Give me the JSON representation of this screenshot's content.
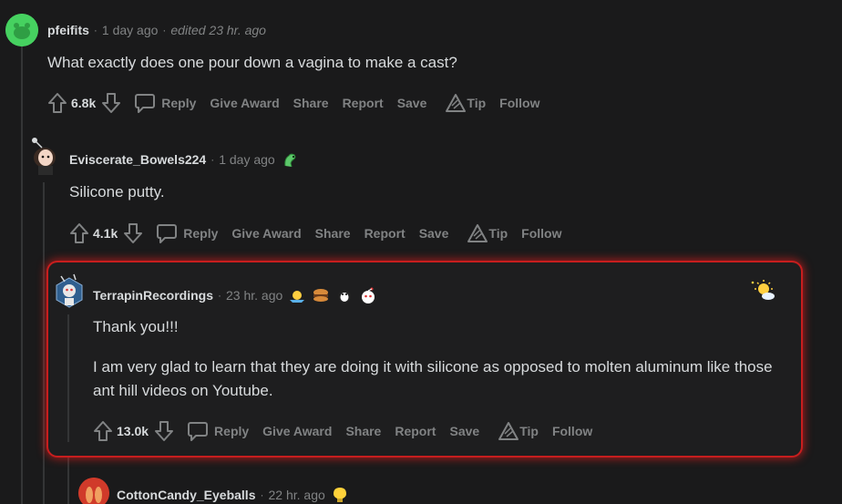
{
  "comments": [
    {
      "author": "pfeifits",
      "time": "1 day ago",
      "edited": "edited 23 hr. ago",
      "body": [
        "What exactly does one pour down a vagina to make a cast?"
      ],
      "votes": "6.8k"
    },
    {
      "author": "Eviscerate_Bowels224",
      "time": "1 day ago",
      "body": [
        "Silicone putty."
      ],
      "votes": "4.1k"
    },
    {
      "author": "TerrapinRecordings",
      "time": "23 hr. ago",
      "body": [
        "Thank you!!!",
        "I am very glad to learn that they are doing it with silicone as opposed to molten aluminum like those ant hill videos on Youtube."
      ],
      "votes": "13.0k"
    },
    {
      "author": "CottonCandy_Eyeballs",
      "time": "22 hr. ago"
    }
  ],
  "actions": {
    "reply": "Reply",
    "give_award": "Give Award",
    "share": "Share",
    "report": "Report",
    "save": "Save",
    "tip": "Tip",
    "follow": "Follow"
  },
  "separator": "·",
  "colors": {
    "background": "#1a1a1b",
    "text": "#d7dadc",
    "meta": "#818384",
    "highlight_border": "#c81e1e",
    "thread_line": "#343536"
  }
}
